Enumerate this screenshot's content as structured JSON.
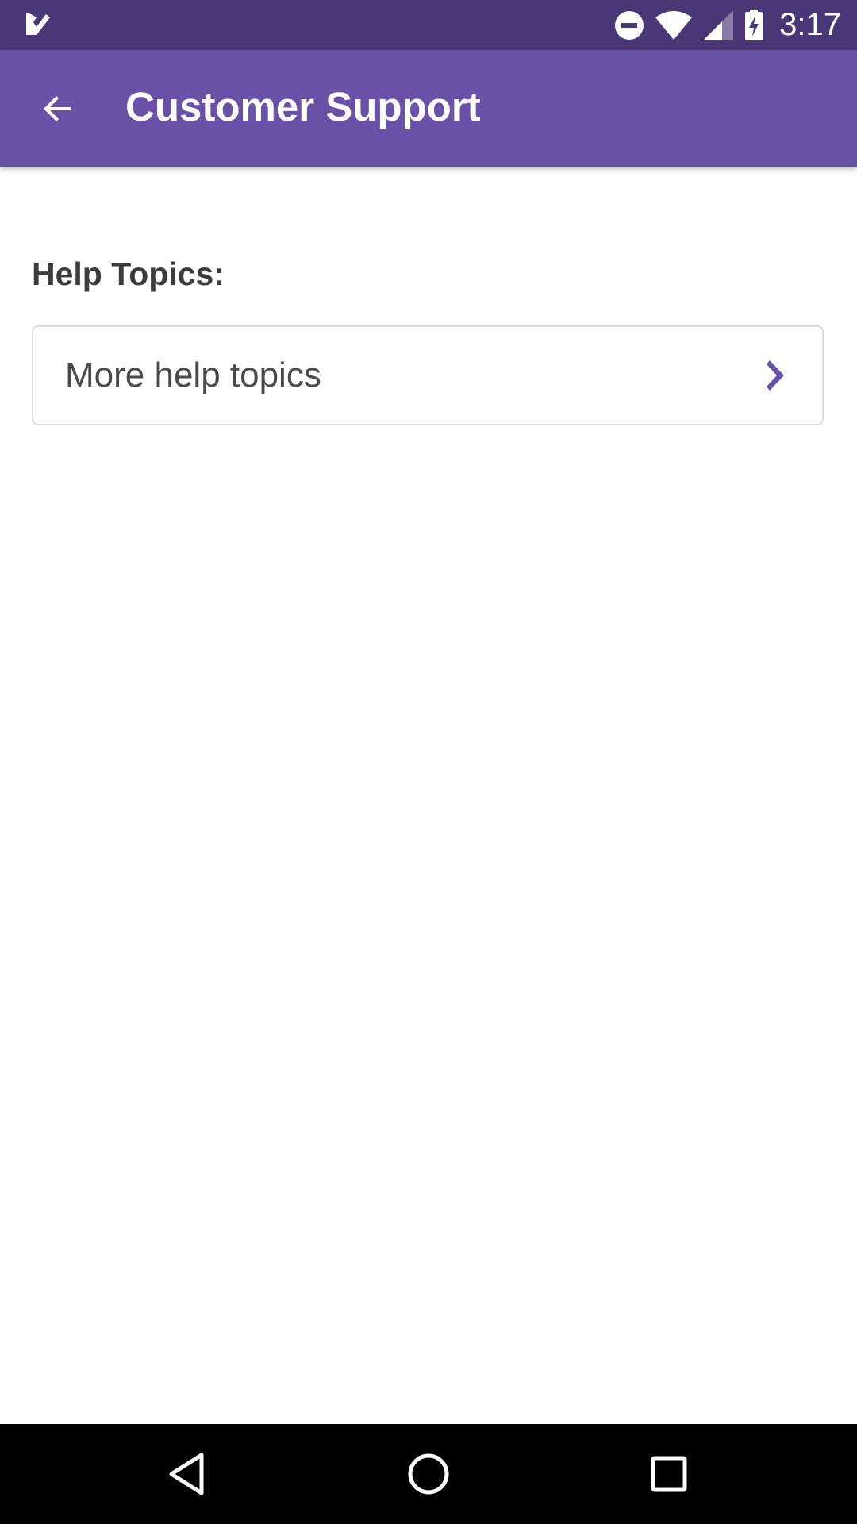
{
  "status_bar": {
    "time": "3:17",
    "icons": [
      "app-notification-icon",
      "do-not-disturb-icon",
      "wifi-icon",
      "signal-icon",
      "battery-charging-icon"
    ]
  },
  "app_bar": {
    "title": "Customer Support",
    "back_icon": "arrow-back-icon"
  },
  "help": {
    "section_label": "Help Topics:",
    "items": [
      {
        "label": "More help topics",
        "icon": "chevron-right-icon"
      }
    ]
  },
  "nav_bar": {
    "buttons": [
      "back",
      "home",
      "recents"
    ]
  },
  "colors": {
    "status_bar": "#4a3775",
    "app_bar": "#6a51a8",
    "accent": "#6a51a8",
    "label_text": "#3c3c3c",
    "item_text": "#4a4a4a",
    "card_border": "#dcdcdc"
  }
}
